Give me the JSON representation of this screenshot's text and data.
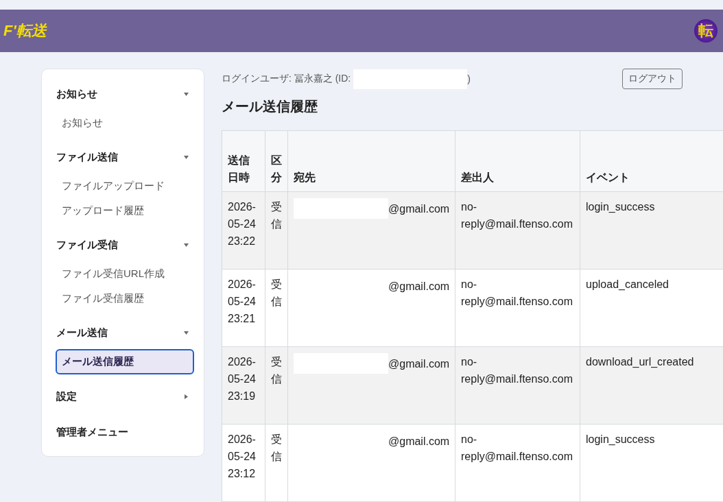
{
  "header": {
    "logo": "F'転送",
    "avatar": "転"
  },
  "sidebar": {
    "groups": [
      {
        "label": "お知らせ",
        "kind": "group",
        "expanded": true,
        "children": [
          {
            "label": "お知らせ",
            "selected": false
          }
        ]
      },
      {
        "label": "ファイル送信",
        "kind": "group",
        "expanded": true,
        "children": [
          {
            "label": "ファイルアップロード",
            "selected": false
          },
          {
            "label": "アップロード履歴",
            "selected": false
          }
        ]
      },
      {
        "label": "ファイル受信",
        "kind": "group",
        "expanded": true,
        "children": [
          {
            "label": "ファイル受信URL作成",
            "selected": false
          },
          {
            "label": "ファイル受信履歴",
            "selected": false
          }
        ]
      },
      {
        "label": "メール送信",
        "kind": "group",
        "expanded": true,
        "children": [
          {
            "label": "メール送信履歴",
            "selected": true
          }
        ]
      },
      {
        "label": "設定",
        "kind": "group",
        "expanded": false
      },
      {
        "label": "管理者メニュー",
        "kind": "link"
      }
    ]
  },
  "user_bar": {
    "login_label": "ログインユーザ: 冨永嘉之 (ID:",
    "id_redacted": true,
    "closing": ")",
    "logout_button": "ログアウト"
  },
  "page_title": "メール送信履歴",
  "table": {
    "columns": [
      "送信日時",
      "区分",
      "宛先",
      "差出人",
      "イベント"
    ],
    "rows": [
      {
        "sent_at": "2026-05-24 23:22",
        "type": "受信",
        "recipient_redacted": true,
        "recipient": "@gmail.com",
        "sender": "no-reply@mail.ftenso.com",
        "event": "login_success"
      },
      {
        "sent_at": "2026-05-24 23:21",
        "type": "受信",
        "recipient_redacted": true,
        "recipient": "@gmail.com",
        "sender": "no-reply@mail.ftenso.com",
        "event": "upload_canceled"
      },
      {
        "sent_at": "2026-05-24 23:19",
        "type": "受信",
        "recipient_redacted": true,
        "recipient": "@gmail.com",
        "sender": "no-reply@mail.ftenso.com",
        "event": "download_url_created"
      },
      {
        "sent_at": "2026-05-24 23:12",
        "type": "受信",
        "recipient_redacted": true,
        "recipient": "@gmail.com",
        "sender": "no-reply@mail.ftenso.com",
        "event": "login_success"
      }
    ]
  }
}
